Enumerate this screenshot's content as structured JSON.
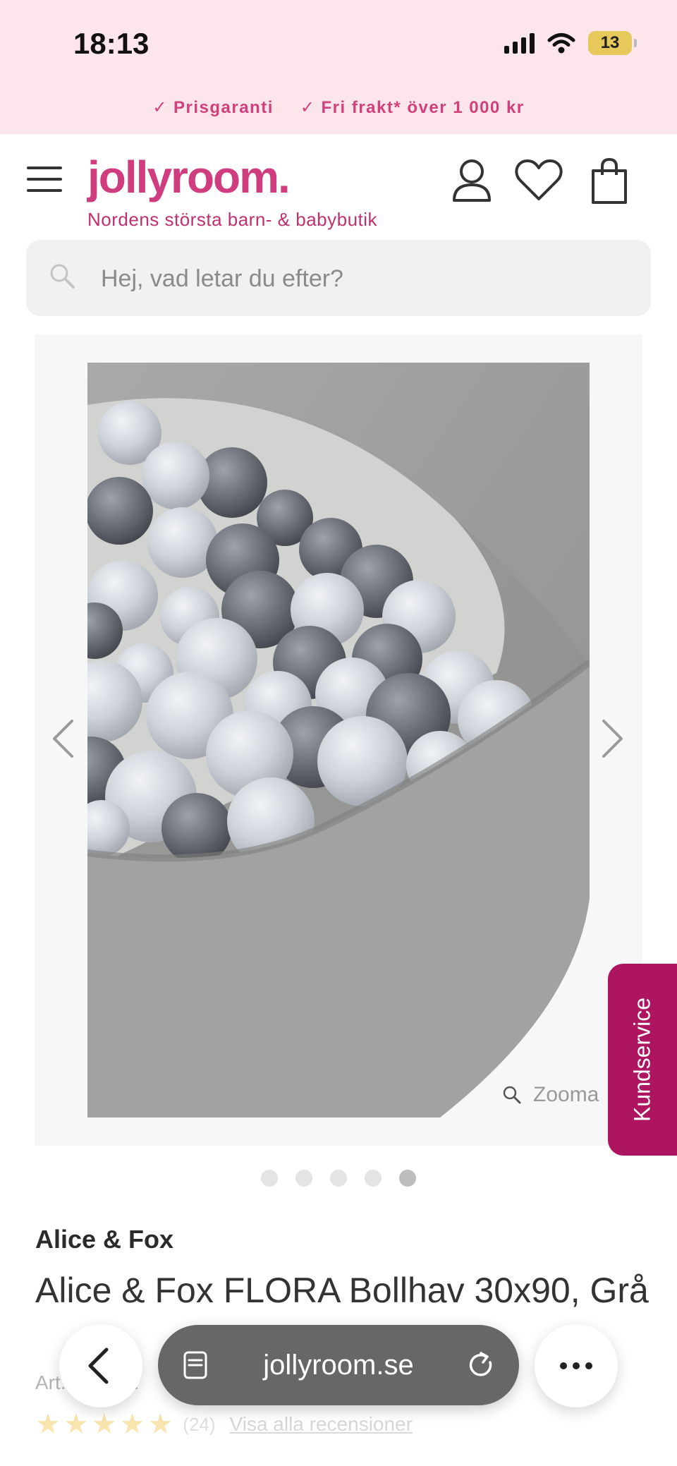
{
  "status_bar": {
    "time": "18:13",
    "battery": "13"
  },
  "promo": [
    {
      "icon": "checkmark-icon",
      "text": "Prisgaranti"
    },
    {
      "icon": "checkmark-icon",
      "text": "Fri frakt* över 1 000 kr"
    }
  ],
  "header": {
    "logo": "jollyroom.",
    "tagline": "Nordens största barn- & babybutik",
    "icons": [
      "menu-icon",
      "account-icon",
      "heart-icon",
      "shopping-bag-icon"
    ]
  },
  "search": {
    "placeholder": "Hej, vad letar du efter?"
  },
  "gallery": {
    "zoom_label": "Zooma",
    "slide_count": 5,
    "active_slide": 5,
    "icons": [
      "chevron-left-icon",
      "chevron-right-icon",
      "magnifier-icon"
    ]
  },
  "kundservice": {
    "label": "Kundservice"
  },
  "product": {
    "brand": "Alice & Fox",
    "title": "Alice & Fox FLORA Bollhav 30x90, Grå",
    "article_no": "Art.nr: 5132",
    "rating": 5,
    "review_count": "(24)",
    "reviews_link": "Visa alla recensioner"
  },
  "browser": {
    "url": "jollyroom.se"
  },
  "colors": {
    "brand_pink": "#cf3d7f",
    "promo_bg": "#fce6ec",
    "kundservice_bg": "#ad1560"
  }
}
